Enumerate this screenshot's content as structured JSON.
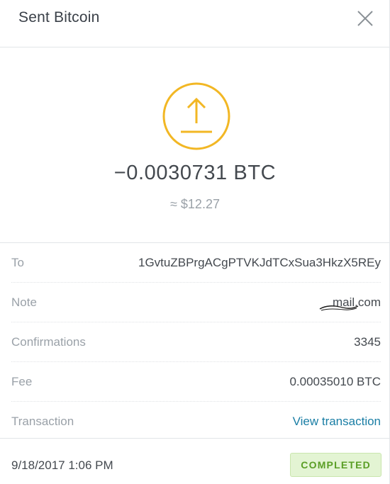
{
  "header": {
    "title": "Sent Bitcoin",
    "close_icon": "close-icon"
  },
  "transaction": {
    "icon": "send-arrow-up-icon",
    "icon_color": "#f2b724",
    "amount": "−0.0030731 BTC",
    "fiat_amount": "≈ $12.27"
  },
  "details": [
    {
      "label": "To",
      "value": "1GvtuZBPrgACgPTVKJdTCxSua3HkzX5REy"
    },
    {
      "label": "Note",
      "value": "mail.com"
    },
    {
      "label": "Confirmations",
      "value": "3345"
    },
    {
      "label": "Fee",
      "value": "0.00035010 BTC"
    },
    {
      "label": "Transaction",
      "value": "View transaction"
    }
  ],
  "footer": {
    "date": "9/18/2017 1:06 PM",
    "status": "COMPLETED"
  },
  "colors": {
    "accent": "#f2b724",
    "link": "#1a7ea5",
    "status_bg": "#e3f4d3",
    "status_text": "#5a9e25"
  }
}
